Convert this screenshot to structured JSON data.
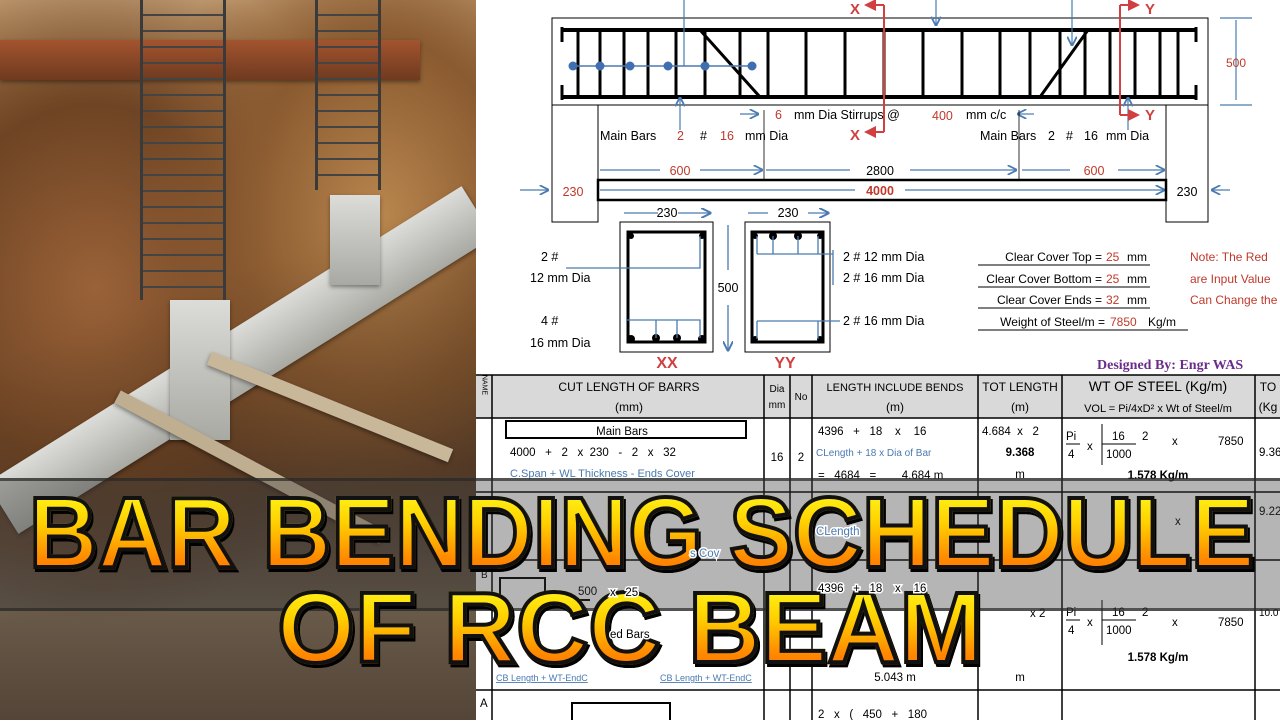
{
  "title": {
    "line1": "BAR BENDING SCHEDULE",
    "line2": "OF RCC BEAM"
  },
  "beam": {
    "depth": "500",
    "stirrup_dia": "6",
    "stirrup_text": "mm Dia Stirrups @",
    "stirrup_spacing": "400",
    "stirrup_unit": "mm c/c",
    "section_x": "X",
    "section_y": "Y",
    "left_main": {
      "label": "Main Bars",
      "count": "2",
      "hash": "#",
      "dia": "16",
      "unit": "mm Dia"
    },
    "right_main": {
      "label": "Main Bars",
      "count": "2",
      "hash": "#",
      "dia": "16",
      "unit": "mm Dia"
    },
    "dims": {
      "left": "600",
      "mid": "2800",
      "right": "600",
      "span": "4000",
      "support_left": "230",
      "support_right": "230"
    }
  },
  "sections": {
    "width_xx": "230",
    "width_yy": "230",
    "depth": "500",
    "xx_label": "XX",
    "yy_label": "YY",
    "xx_top": {
      "count": "2 #",
      "dia": "12  mm Dia"
    },
    "xx_bottom": {
      "count": "4  #",
      "dia": "16  mm Dia"
    },
    "yy": [
      "2  #  12  mm Dia",
      "2  #  16  mm Dia",
      "2  #  16  mm Dia"
    ]
  },
  "covers": [
    {
      "label": "Clear Cover Top =",
      "value": "25",
      "unit": "mm"
    },
    {
      "label": "Clear Cover Bottom =",
      "value": "25",
      "unit": "mm"
    },
    {
      "label": "Clear Cover Ends =",
      "value": "32",
      "unit": "mm"
    },
    {
      "label": "Weight of Steel/m =",
      "value": "7850",
      "unit": "Kg/m"
    }
  ],
  "note": [
    "Note: The Red",
    "are Input Value",
    "Can Change the"
  ],
  "designed_by": "Designed By: Engr WAS",
  "table": {
    "headers": {
      "name": "NAME",
      "cut": "CUT LENGTH OF BARRS",
      "cut_unit": "(mm)",
      "dia": "Dia",
      "dia_unit": "mm",
      "no": "No",
      "bends": "LENGTH INCLUDE BENDS",
      "bends_unit": "(m)",
      "tot": "TOT LENGTH",
      "tot_unit": "(m)",
      "wt": "WT OF STEEL (Kg/m)",
      "wt_formula": "VOL = Pi/4xD² x Wt of Steel/m",
      "total": "TO",
      "total_unit": "(Kg"
    },
    "row1": {
      "bar_name": "Main Bars",
      "calc": "4000   +   2   x  230   -   2   x   32",
      "legend": "C.Span  +  WL Thickness  -  Ends Cover",
      "dia": "16",
      "no": "2",
      "bends": "4396   +   18    x    16",
      "bends_formula": "CLength + 18 x Dia of Bar",
      "bends_result": "=   4684   =        4.684 m",
      "tot": "4.684  x   2",
      "tot_value": "9.368",
      "tot_unit": "m",
      "wt_pi": "Pi",
      "wt_4": "4",
      "wt_x": "x",
      "wt_num": "16",
      "wt_den": "1000",
      "wt_pow": "2",
      "wt_x2": "x",
      "wt_steel": "7850",
      "wt_result": "1.578 Kg/m",
      "total": "9.36"
    },
    "row2": {
      "total": "9.22",
      "partial": "x",
      "formula_partial": "CLength",
      "legend_partial": "s Cov"
    },
    "row3": {
      "name_letter": "B",
      "dim": "500",
      "calc_partial": "x   25",
      "bar_name_partial": "ed Bars",
      "legend_a": "CB Length + WT-EndC",
      "legend_b": "CB Length + WT-EndC",
      "bends_partial": "4396   +   18    x    16",
      "bends_result": "5.043 m",
      "tot_partial": "x   2",
      "tot_unit": "m",
      "wt_pi": "Pi",
      "wt_4": "4",
      "wt_x": "x",
      "wt_num": "16",
      "wt_den": "1000",
      "wt_pow": "2",
      "wt_x2": "x",
      "wt_steel": "7850",
      "wt_result": "1.578 Kg/m",
      "total": "10.0"
    },
    "row4": {
      "name_letter": "A",
      "bends": "2   x   (   450   +   180"
    }
  },
  "colors": {
    "input_red": "#c0392b",
    "dim_blue": "#4a7ab0",
    "header_gray": "#d9d9d9",
    "designer_purple": "#6a2c8a",
    "title_yellow": "#ffff20",
    "title_orange": "#ff6a00"
  }
}
